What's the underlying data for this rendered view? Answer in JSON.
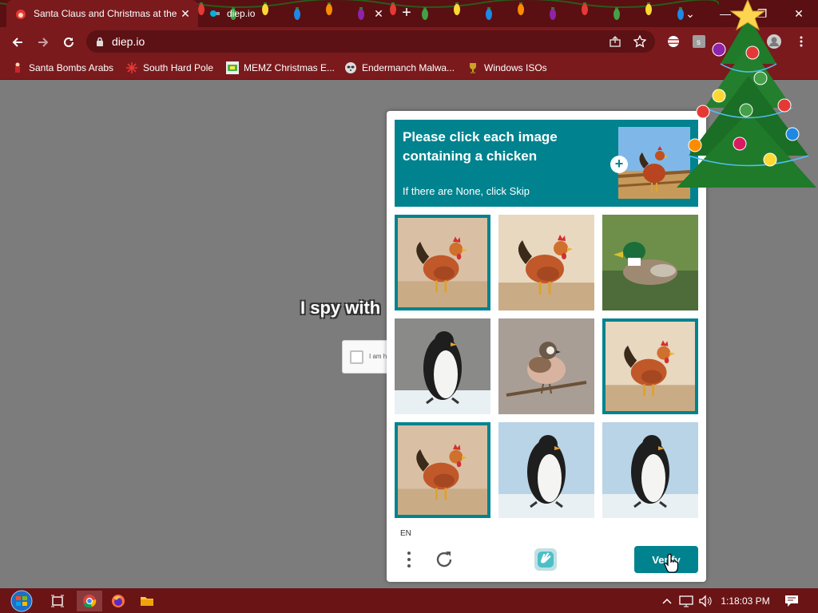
{
  "browser": {
    "tabs": [
      {
        "title": "Santa Claus and Christmas at the"
      },
      {
        "title": "diep.io"
      }
    ],
    "url": "diep.io",
    "bookmarks": [
      {
        "label": "Santa Bombs Arabs"
      },
      {
        "label": "South Hard Pole"
      },
      {
        "label": "MEMZ Christmas E..."
      },
      {
        "label": "Endermanch Malwa..."
      },
      {
        "label": "Windows ISOs"
      }
    ],
    "glyphs": {
      "close": "✕",
      "new_tab": "+",
      "minimize": "—",
      "restore": "❐",
      "chevron": "⌄"
    }
  },
  "page": {
    "heading": "I spy with",
    "anchor_label": "I am h"
  },
  "captcha": {
    "prompt": "Please click each image containing a chicken",
    "hint": "If there are None, click Skip",
    "language": "EN",
    "verify_label": "Verify",
    "accent_color": "#00838f",
    "tiles": [
      {
        "subject": "chicken",
        "selected": true
      },
      {
        "subject": "chicken",
        "selected": false
      },
      {
        "subject": "duck",
        "selected": false
      },
      {
        "subject": "penguin",
        "selected": false
      },
      {
        "subject": "sparrow",
        "selected": false
      },
      {
        "subject": "chicken",
        "selected": true
      },
      {
        "subject": "chicken",
        "selected": true
      },
      {
        "subject": "penguin",
        "selected": false
      },
      {
        "subject": "penguin",
        "selected": false
      }
    ]
  },
  "taskbar": {
    "time": "1:18:03 PM",
    "icons": [
      "start-orb-icon",
      "task-view-icon",
      "chrome-icon",
      "firefox-icon",
      "file-explorer-icon"
    ],
    "tray_icons": [
      "tray-chevron-icon",
      "network-icon",
      "volume-icon",
      "notification-icon"
    ]
  }
}
